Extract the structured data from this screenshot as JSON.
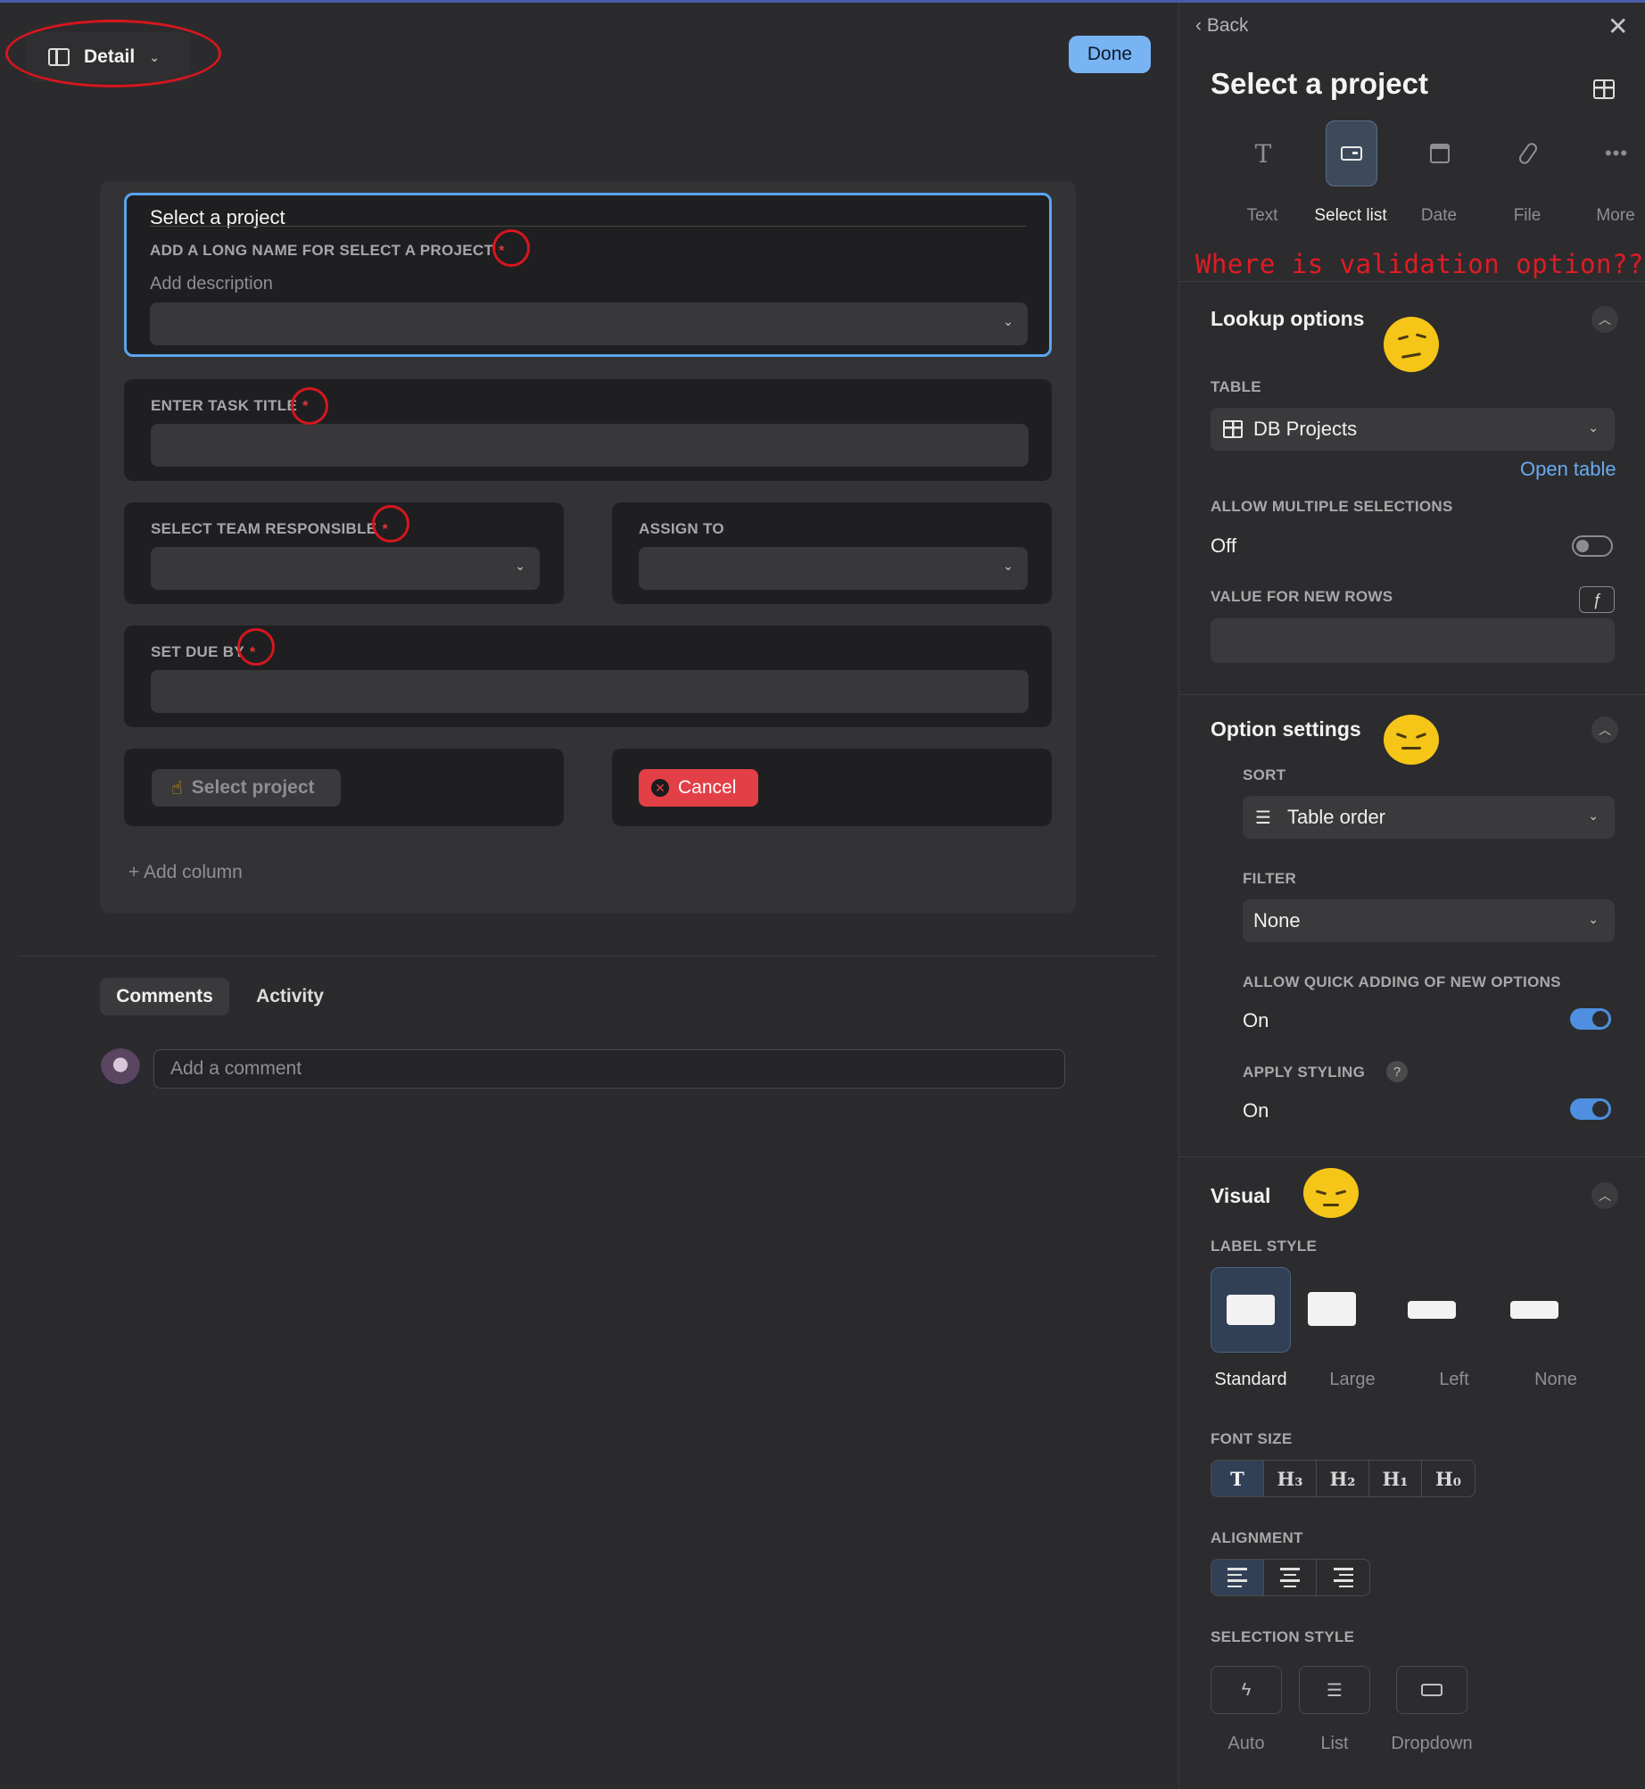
{
  "toolbar": {
    "view_label": "Detail",
    "done_label": "Done"
  },
  "form": {
    "select_field": {
      "title": "Select a project",
      "label": "ADD A LONG NAME FOR SELECT A PROJECT",
      "required_mark": "*",
      "description_placeholder": "Add description"
    },
    "task_title": {
      "label": "ENTER TASK TITLE",
      "required_mark": "*"
    },
    "team": {
      "label": "SELECT TEAM RESPONSIBLE",
      "required_mark": "*"
    },
    "assign": {
      "label": "ASSIGN TO"
    },
    "due": {
      "label": "SET DUE BY",
      "required_mark": "*"
    },
    "select_project_button": {
      "emoji": "☝",
      "label": "Select project"
    },
    "cancel_button": {
      "label": "Cancel"
    },
    "add_column": "+ Add column"
  },
  "tabs": [
    {
      "label": "Comments",
      "active": true
    },
    {
      "label": "Activity",
      "active": false
    }
  ],
  "comment": {
    "placeholder": "Add a comment"
  },
  "panel": {
    "back_label": "Back",
    "title": "Select a project",
    "field_types": [
      {
        "label": "Text",
        "icon": "text-icon",
        "active": false
      },
      {
        "label": "Select list",
        "icon": "select-list-icon",
        "active": true
      },
      {
        "label": "Date",
        "icon": "calendar-icon",
        "active": false
      },
      {
        "label": "File",
        "icon": "paperclip-icon",
        "active": false
      },
      {
        "label": "More",
        "icon": "more-icon",
        "active": false
      }
    ],
    "annotation": "Where is validation option??",
    "lookup": {
      "title": "Lookup options",
      "table_label": "TABLE",
      "table_value": "DB Projects",
      "open_table": "Open table",
      "multiple_label": "ALLOW MULTIPLE SELECTIONS",
      "multiple_value": "Off",
      "new_rows_label": "VALUE FOR NEW ROWS",
      "fx": "ƒ"
    },
    "options": {
      "title": "Option settings",
      "sort_label": "SORT",
      "sort_value": "Table order",
      "filter_label": "FILTER",
      "filter_value": "None",
      "quick_add_label": "ALLOW QUICK ADDING OF NEW OPTIONS",
      "quick_add_value": "On",
      "styling_label": "APPLY STYLING",
      "styling_value": "On",
      "help": "?"
    },
    "visual": {
      "title": "Visual",
      "label_style_label": "LABEL STYLE",
      "label_styles": [
        "Standard",
        "Large",
        "Left",
        "None"
      ],
      "font_size_label": "FONT SIZE",
      "font_sizes": [
        "T",
        "H₃",
        "H₂",
        "H₁",
        "H₀"
      ],
      "alignment_label": "ALIGNMENT",
      "selection_style_label": "SELECTION STYLE",
      "selection_styles": [
        "Auto",
        "List",
        "Dropdown"
      ]
    }
  },
  "colors": {
    "accent": "#5aa4ef",
    "annotation_red": "#e01b24",
    "cancel_red": "#e33f47",
    "emoji_yellow": "#f5c518"
  }
}
